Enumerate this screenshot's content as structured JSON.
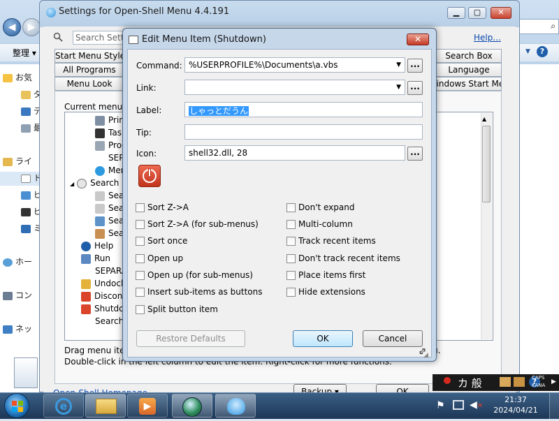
{
  "explorer": {
    "left_items": [
      "お気",
      "ダ",
      "デ",
      "最",
      "ライ",
      "ド",
      "ピ",
      "ビ",
      "ミ",
      "ホー",
      "コン",
      "ネッ"
    ],
    "toolbar_organize": "整理 ▾"
  },
  "settings": {
    "title": "Settings for Open-Shell Menu 4.4.191",
    "search_placeholder": "Search Settings",
    "help_link": "Help...",
    "tabs_row1": [
      "Start Menu Style",
      "Search Box"
    ],
    "tabs_row2": [
      "All Programs",
      "Language"
    ],
    "tabs_row3": [
      "Menu Look",
      "Windows Start Menu"
    ],
    "current_menu_label": "Current menu items:",
    "tree_items": [
      "Printers",
      "Taskbar",
      "Programs",
      "SEPARATOR",
      "Menu",
      "Search",
      "Search",
      "Search",
      "Search",
      "Search",
      "Help",
      "Run",
      "SEPARATOR",
      "Undock",
      "Disconnect",
      "Shutdown",
      "Search"
    ],
    "bottom_line1": "Drag menu items to reorder them. Drag a menu item onto another to create a sub-menu.",
    "bottom_line2": "Double-click in the left column to edit the item. Right-click for more functions.",
    "bottom_link": "Open-Shell Homepage",
    "backup_button": "Backup ▾",
    "ok_button": "OK"
  },
  "dialog": {
    "title": "Edit Menu Item (Shutdown)",
    "close_glyph": "✕",
    "command_label": "Command:",
    "command_value": "%USERPROFILE%\\Documents\\a.vbs",
    "link_label": "Link:",
    "link_value": "",
    "label_label": "Label:",
    "label_value": "しゃっとだうん",
    "tip_label": "Tip:",
    "tip_value": "",
    "icon_label": "Icon:",
    "icon_value": "shell32.dll, 28",
    "browse_glyph": "...",
    "checkboxes_left": [
      "Sort Z->A",
      "Sort Z->A (for sub-menus)",
      "Sort once",
      "Open up",
      "Open up (for sub-menus)",
      "Insert sub-items as buttons",
      "Split button item"
    ],
    "checkboxes_right": [
      "Don't expand",
      "Multi-column",
      "Track recent items",
      "Don't track recent items",
      "Place items first",
      "Hide extensions"
    ],
    "restore_defaults": "Restore Defaults",
    "ok": "OK",
    "cancel": "Cancel"
  },
  "ime": {
    "text": "カ 般",
    "caps": "CAPS",
    "kana": "KANA"
  },
  "taskbar": {
    "time": "21:37",
    "date": "2024/04/21"
  },
  "colors": {
    "selection": "#3399ff",
    "taskbar": "#1c3656",
    "power_icon": "#d9442b"
  }
}
